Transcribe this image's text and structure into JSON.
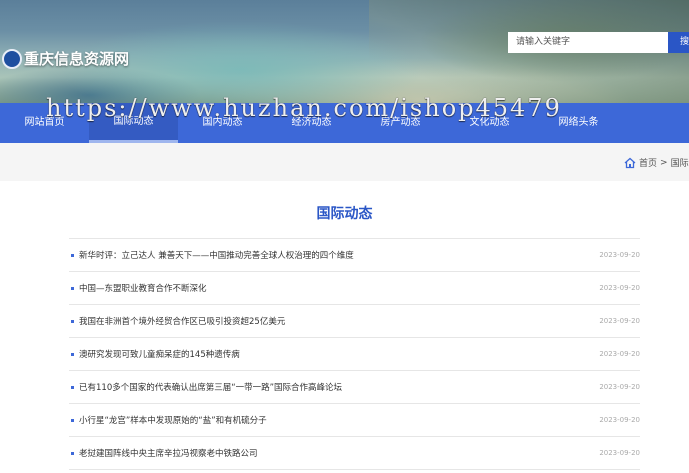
{
  "site": {
    "name": "重庆信息资源网"
  },
  "search": {
    "placeholder": "请输入关键字",
    "button_label": "搜"
  },
  "nav": {
    "items": [
      {
        "label": "网站首页"
      },
      {
        "label": "国际动态"
      },
      {
        "label": "国内动态"
      },
      {
        "label": "经济动态"
      },
      {
        "label": "房产动态"
      },
      {
        "label": "文化动态"
      },
      {
        "label": "网络头条"
      }
    ],
    "active_index": 1
  },
  "watermark": "https://www.huzhan.com/ishop45479",
  "breadcrumb": {
    "home": "首页",
    "separator": ">",
    "current": "国际动态"
  },
  "page": {
    "title": "国际动态"
  },
  "articles": [
    {
      "title": "新华时评：立己达人 兼善天下——中国推动完善全球人权治理的四个维度",
      "date": "2023-09-20"
    },
    {
      "title": "中国—东盟职业教育合作不断深化",
      "date": "2023-09-20"
    },
    {
      "title": "我国在非洲首个境外经贸合作区已吸引投资超25亿美元",
      "date": "2023-09-20"
    },
    {
      "title": "澳研究发现可致儿童痴呆症的145种遗传病",
      "date": "2023-09-20"
    },
    {
      "title": "已有110多个国家的代表确认出席第三届“一带一路”国际合作高峰论坛",
      "date": "2023-09-20"
    },
    {
      "title": "小行星“龙宫”样本中发现原始的“盐”和有机硫分子",
      "date": "2023-09-20"
    },
    {
      "title": "老挝建国阵线中央主席辛拉冯视察老中铁路公司",
      "date": "2023-09-20"
    }
  ],
  "colors": {
    "accent": "#3d68d8",
    "title": "#2a56c6"
  }
}
